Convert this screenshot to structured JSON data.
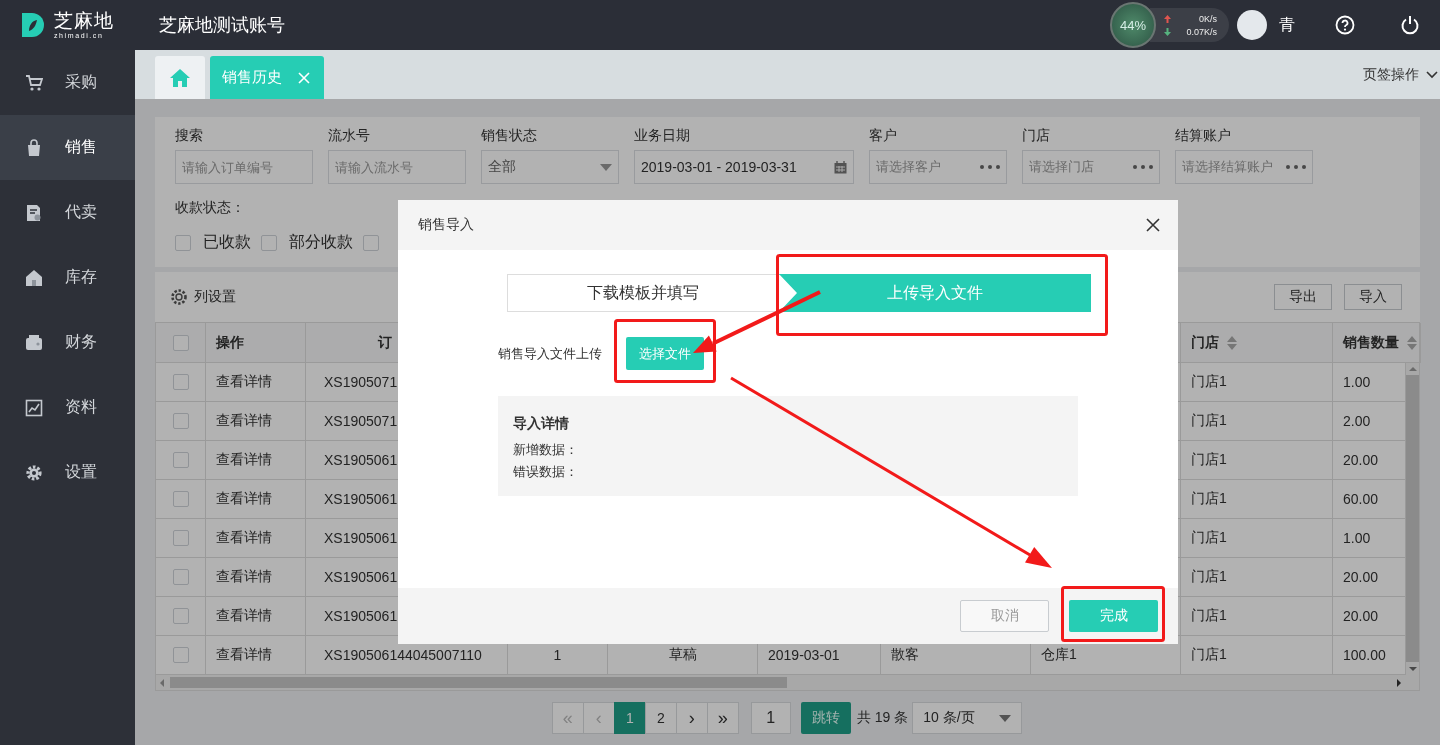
{
  "header": {
    "logo_text": "芝麻地",
    "logo_subtext": "zhimadi.cn",
    "account": "芝麻地测试账号",
    "net_widget": {
      "percent": "44%",
      "upload": "0K/s",
      "download": "0.07K/s"
    },
    "user": "青"
  },
  "sidebar": {
    "items": [
      {
        "label": "采购",
        "selected": false
      },
      {
        "label": "销售",
        "selected": true
      },
      {
        "label": "代卖",
        "selected": false
      },
      {
        "label": "库存",
        "selected": false
      },
      {
        "label": "财务",
        "selected": false
      },
      {
        "label": "资料",
        "selected": false
      },
      {
        "label": "设置",
        "selected": false
      }
    ]
  },
  "tabs": [
    {
      "kind": "home",
      "selected": false
    },
    {
      "kind": "page",
      "label": "销售历史",
      "selected": true
    }
  ],
  "tab_actions": "页签操作",
  "filters": {
    "fields": [
      {
        "kind": "input",
        "label": "搜索",
        "placeholder": "请输入订单编号"
      },
      {
        "kind": "input",
        "label": "流水号",
        "placeholder": "请输入流水号"
      },
      {
        "kind": "select",
        "label": "销售状态",
        "value": "全部"
      },
      {
        "kind": "date",
        "label": "业务日期",
        "value": "2019-03-01 - 2019-03-31"
      },
      {
        "kind": "picker",
        "label": "客户",
        "placeholder": "请选择客户"
      },
      {
        "kind": "picker",
        "label": "门店",
        "placeholder": "请选择门店"
      },
      {
        "kind": "picker",
        "label": "结算账户",
        "placeholder": "请选择结算账户"
      }
    ],
    "payment_status": {
      "label": "收款状态：",
      "options": [
        {
          "label": "已收款",
          "checked": false
        },
        {
          "label": "部分收款",
          "checked": false
        },
        {
          "checked": false
        }
      ]
    }
  },
  "toolbar": {
    "column_settings": "列设置",
    "buttons": [
      "导出",
      "导入"
    ]
  },
  "table": {
    "all_checked": false,
    "columns": {
      "action": {
        "label": "操作",
        "sortable": false
      },
      "order_no": {
        "label": "订",
        "sortable": false
      },
      "store": {
        "label": "门店",
        "sortable": true
      },
      "quantity": {
        "label": "销售数量",
        "sortable": true
      }
    },
    "rows": [
      {
        "checked": false,
        "cells": {
          "action": "查看详情",
          "order_no": "XS1905071",
          "store": "门店1",
          "quantity": "1.00"
        }
      },
      {
        "checked": false,
        "cells": {
          "action": "查看详情",
          "order_no": "XS1905071",
          "store": "门店1",
          "quantity": "2.00"
        }
      },
      {
        "checked": false,
        "cells": {
          "action": "查看详情",
          "order_no": "XS1905061",
          "store": "门店1",
          "quantity": "20.00"
        }
      },
      {
        "checked": false,
        "cells": {
          "action": "查看详情",
          "order_no": "XS1905061",
          "store": "门店1",
          "quantity": "60.00"
        }
      },
      {
        "checked": false,
        "cells": {
          "action": "查看详情",
          "order_no": "XS1905061",
          "store": "门店1",
          "quantity": "1.00"
        }
      },
      {
        "checked": false,
        "cells": {
          "action": "查看详情",
          "order_no": "XS1905061",
          "store": "门店1",
          "quantity": "20.00"
        }
      },
      {
        "checked": false,
        "cells": {
          "action": "查看详情",
          "order_no": "XS1905061",
          "store": "门店1",
          "quantity": "20.00"
        }
      },
      {
        "checked": false,
        "cells": {
          "action": "查看详情",
          "order_no": "XS190506144045007110",
          "column_4": "1",
          "column_5": "草稿",
          "column_6": "2019-03-01",
          "column_7": "散客",
          "column_8": "仓库1",
          "store": "门店1",
          "quantity": "100.00"
        }
      }
    ]
  },
  "pagination": {
    "items": [
      {
        "kind": "nav",
        "label": "«",
        "selected": false,
        "disabled": true
      },
      {
        "kind": "nav",
        "label": "‹",
        "selected": false,
        "disabled": true
      },
      {
        "kind": "page",
        "label": "1",
        "selected": true,
        "disabled": false
      },
      {
        "kind": "page",
        "label": "2",
        "selected": false,
        "disabled": false
      },
      {
        "kind": "nav",
        "label": "›",
        "selected": false,
        "disabled": false
      },
      {
        "kind": "nav",
        "label": "»",
        "selected": false,
        "disabled": false
      }
    ],
    "jump_value": "1",
    "jump_button": "跳转",
    "total": "共 19 条",
    "page_size": "10 条/页"
  },
  "modal": {
    "title": "销售导入",
    "steps": [
      {
        "label": "下载模板并填写",
        "selected": false
      },
      {
        "label": "上传导入文件",
        "selected": true
      }
    ],
    "upload_label": "销售导入文件上传",
    "upload_button": "选择文件",
    "details": {
      "title": "导入详情",
      "lines": [
        "新增数据：",
        "错误数据："
      ]
    },
    "buttons": [
      {
        "kind": "secondary",
        "label": "取消"
      },
      {
        "kind": "primary",
        "label": "完成"
      }
    ]
  }
}
